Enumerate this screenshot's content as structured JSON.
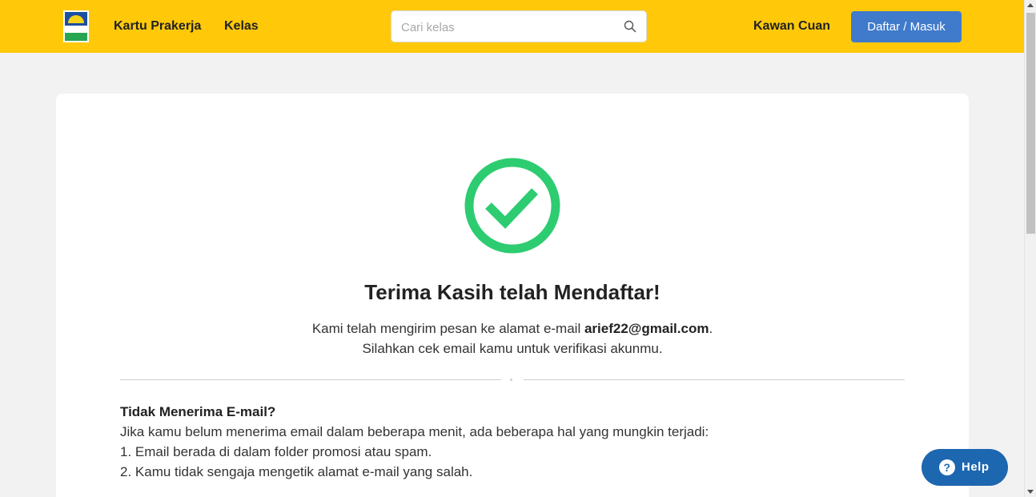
{
  "header": {
    "logo_alt": "SIAP KERJA",
    "nav": {
      "kartu_prakerja": "Kartu Prakerja",
      "kelas": "Kelas",
      "kawan_cuan": "Kawan Cuan"
    },
    "search": {
      "placeholder": "Cari kelas",
      "value": ""
    },
    "login_label": "Daftar / Masuk"
  },
  "main": {
    "title": "Terima Kasih telah Mendaftar!",
    "message_prefix": "Kami telah mengirim pesan ke alamat e-mail ",
    "email": "arief22@gmail.com",
    "message_suffix": ".",
    "message_line2": "Silahkan cek email kamu untuk verifikasi akunmu.",
    "info": {
      "title": "Tidak Menerima E-mail?",
      "intro": "Jika kamu belum menerima email dalam beberapa menit, ada beberapa hal yang mungkin terjadi:",
      "items": [
        "1. Email berada di dalam folder promosi atau spam.",
        "2. Kamu tidak sengaja mengetik alamat e-mail yang salah."
      ]
    }
  },
  "help": {
    "label": "Help",
    "icon": "question-icon"
  },
  "colors": {
    "header_bg": "#ffc90a",
    "primary_button": "#3f7acb",
    "success_green": "#2ecc71",
    "help_button": "#1d67b0"
  }
}
